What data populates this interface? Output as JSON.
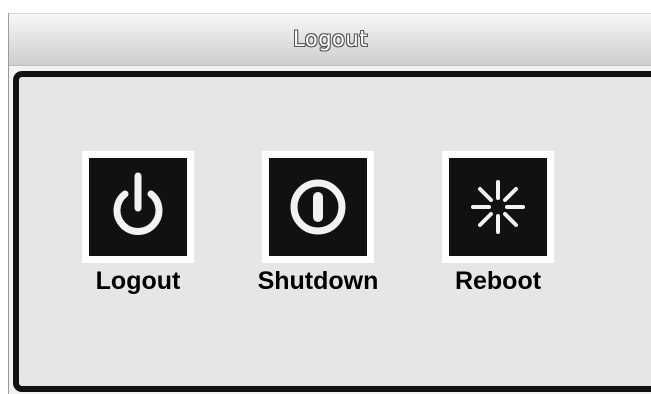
{
  "window": {
    "title": "Logout"
  },
  "options": [
    {
      "label": "Logout",
      "icon": "power-icon"
    },
    {
      "label": "Shutdown",
      "icon": "shutdown-icon"
    },
    {
      "label": "Reboot",
      "icon": "reboot-icon"
    }
  ],
  "colors": {
    "panel_background": "#e6e6e6",
    "panel_border": "#111111",
    "icon_tile": "#111111",
    "icon_glyph": "#f2f2f2"
  }
}
